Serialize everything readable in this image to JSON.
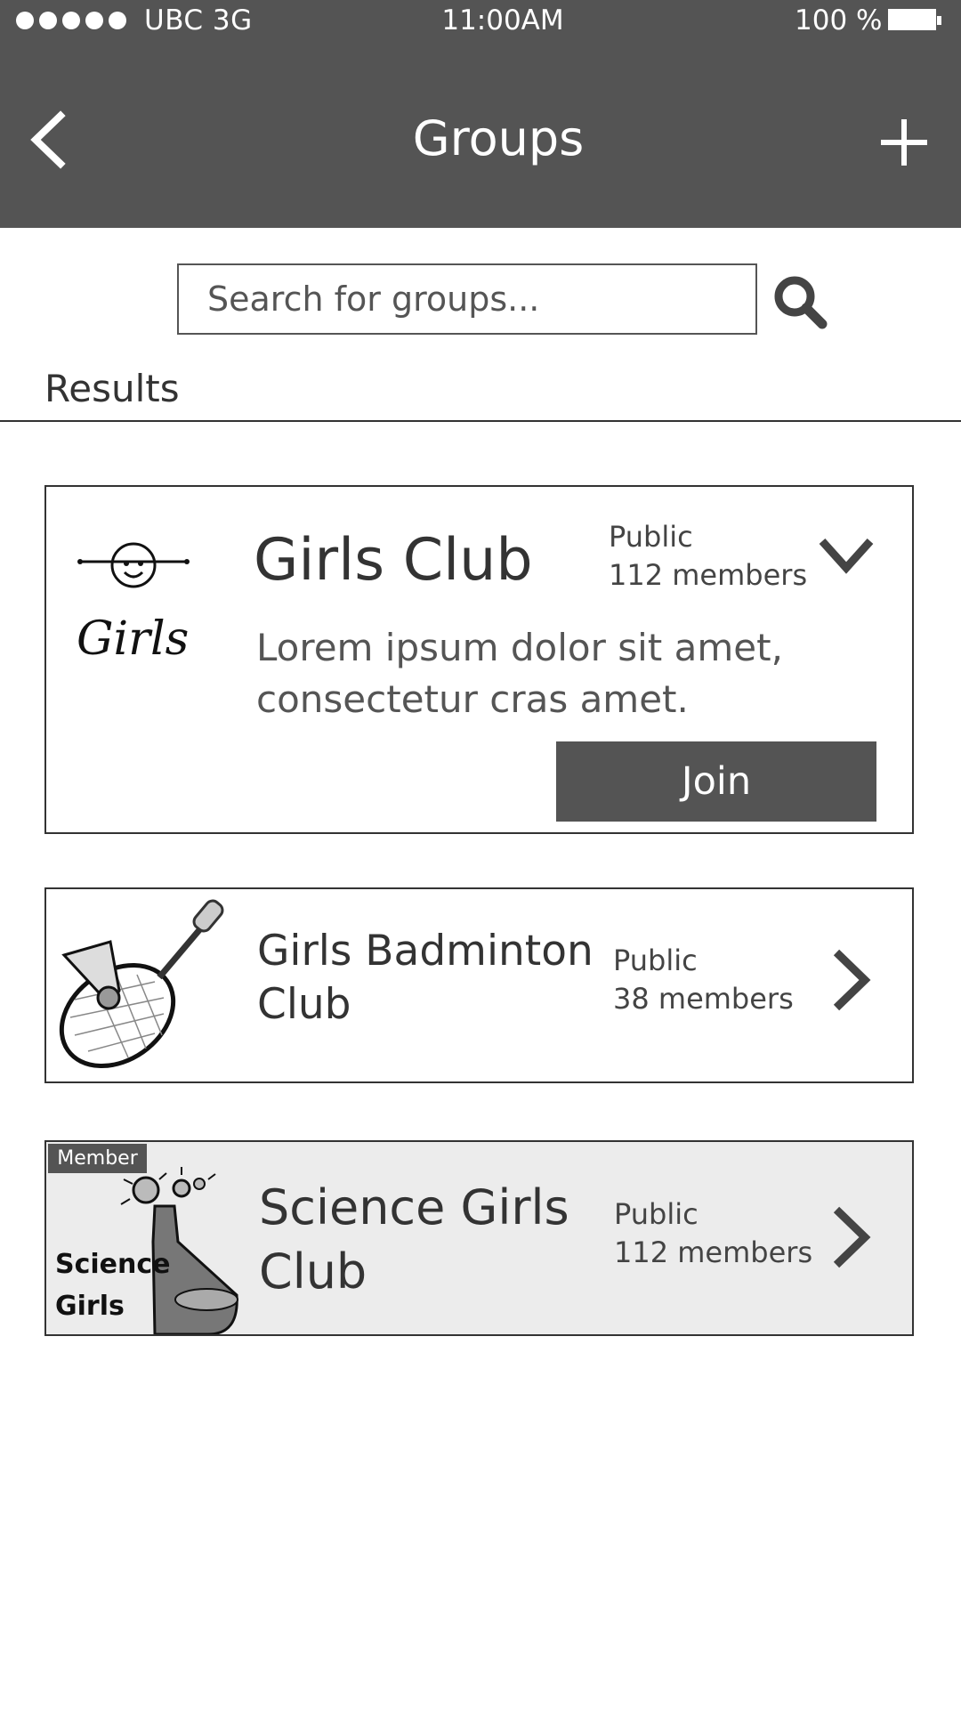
{
  "status_bar": {
    "carrier": "UBC  3G",
    "time": "11:00AM",
    "battery": "100 %"
  },
  "nav": {
    "title": "Groups",
    "back_icon": "chevron-left-icon",
    "add_icon": "plus-icon"
  },
  "search": {
    "placeholder": "Search for groups...",
    "icon": "search-icon"
  },
  "results": {
    "heading": "Results",
    "groups": [
      {
        "name": "Girls Club",
        "visibility": "Public",
        "members": "112 members",
        "description_line1": "Lorem ipsum dolor sit amet,",
        "description_line2": "consectetur cras amet.",
        "join_label": "Join",
        "logo_text": "Girls",
        "expand_icon": "chevron-down-icon"
      },
      {
        "name_line1": "Girls Badminton",
        "name_line2": "Club",
        "visibility": "Public",
        "members": "38 members",
        "open_icon": "chevron-right-icon"
      },
      {
        "badge": "Member",
        "name_line1": "Science Girls",
        "name_line2": "Club",
        "visibility": "Public",
        "members": "112 members",
        "logo_text_line1": "Science",
        "logo_text_line2": "Girls",
        "open_icon": "chevron-right-icon"
      }
    ]
  }
}
